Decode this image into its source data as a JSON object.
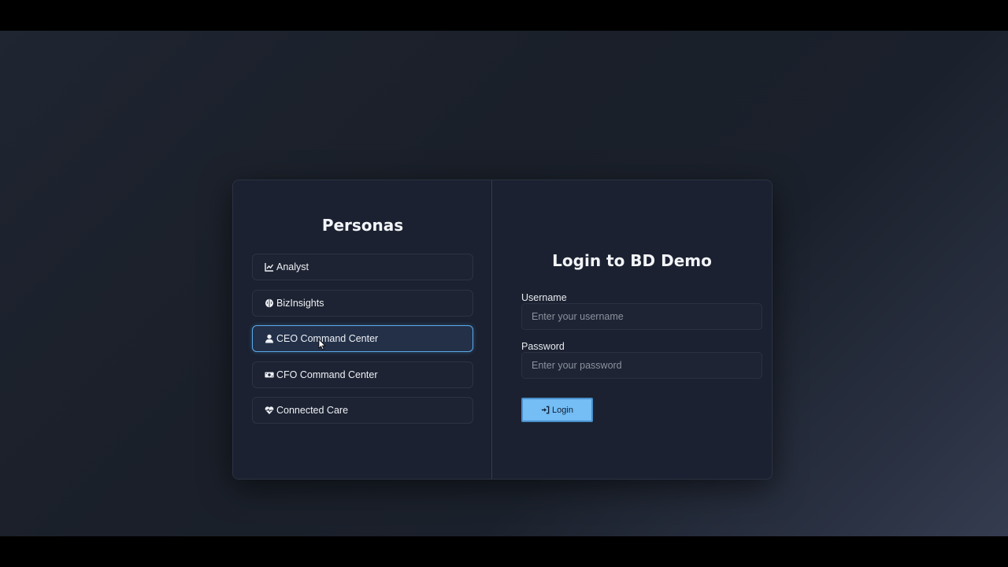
{
  "personas_panel": {
    "title": "Personas",
    "items": [
      {
        "label": "Analyst",
        "icon": "chart-line-icon"
      },
      {
        "label": "BizInsights",
        "icon": "brain-icon"
      },
      {
        "label": "CEO Command Center",
        "icon": "user-icon",
        "selected": true
      },
      {
        "label": "CFO Command Center",
        "icon": "money-bill-icon"
      },
      {
        "label": "Connected Care",
        "icon": "heart-pulse-icon"
      }
    ]
  },
  "login": {
    "title": "Login to BD Demo",
    "username_label": "Username",
    "username_placeholder": "Enter your username",
    "username_value": "",
    "password_label": "Password",
    "password_placeholder": "Enter your password",
    "password_value": "",
    "button_label": "Login",
    "button_icon": "sign-in-icon"
  },
  "colors": {
    "accent": "#74bdf5",
    "selected_border": "#5aa9ea",
    "card_background": "#1b2130"
  }
}
